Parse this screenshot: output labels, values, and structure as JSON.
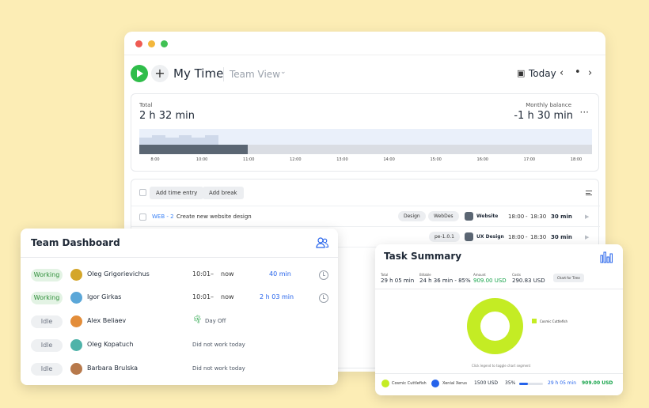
{
  "app": {
    "title": "My Time",
    "view_dropdown": "Team View",
    "date_label": "Today",
    "nav_prev": "‹",
    "nav_current": "•",
    "nav_next": "›",
    "add_symbol": "+",
    "more_symbol": "···"
  },
  "summary": {
    "total_label": "Total",
    "total_value": "2 h 32 min",
    "balance_label": "Monthly balance",
    "balance_value": "-1 h 30 min",
    "timeline_fill_fraction": 0.24,
    "ticks": [
      "8:00",
      "10:00",
      "11:00",
      "12:00",
      "13:00",
      "14:00",
      "15:00",
      "16:00",
      "17:00",
      "18:00"
    ]
  },
  "entries": {
    "add_entry_label": "Add time entry",
    "add_break_label": "Add break",
    "rows": [
      {
        "project": "WEB - 2",
        "description": "Create new website design",
        "tags": [
          "Design",
          "WebDes"
        ],
        "project_name": "Website",
        "start": "18:00",
        "dash": "-",
        "end": "18:30",
        "duration": "30 min"
      },
      {
        "project": "",
        "description": "",
        "tags": [
          "pe-1.0.1"
        ],
        "project_name": "UX Design",
        "start": "18:00",
        "dash": "-",
        "end": "18:30",
        "duration": "30 min"
      }
    ]
  },
  "team_dashboard": {
    "title": "Team Dashboard",
    "members": [
      {
        "status": "Working",
        "name": "Oleg Grigorievichus",
        "start": "10:01",
        "dash": "–",
        "end": "now",
        "duration": "40 min",
        "note": ""
      },
      {
        "status": "Working",
        "name": "Igor Girkas",
        "start": "10:01",
        "dash": "–",
        "end": "now",
        "duration": "2 h 03 min",
        "note": ""
      },
      {
        "status": "Idle",
        "name": "Alex Beliaev",
        "start": "",
        "dash": "",
        "end": "",
        "duration": "",
        "note": "Day Off"
      },
      {
        "status": "Idle",
        "name": "Oleg Kopatuch",
        "start": "",
        "dash": "",
        "end": "",
        "duration": "",
        "note": "Did not work today"
      },
      {
        "status": "Idle",
        "name": "Barbara Brulska",
        "start": "",
        "dash": "",
        "end": "",
        "duration": "",
        "note": "Did not work today"
      }
    ]
  },
  "task_summary": {
    "title": "Task Summary",
    "stats": [
      {
        "label": "Total",
        "value": "29 h 05 min"
      },
      {
        "label": "Billable",
        "value": "24 h 36 min - 85%"
      },
      {
        "label": "Amount",
        "value": "909.00 USD"
      },
      {
        "label": "Costs",
        "value": "290.83 USD"
      }
    ],
    "group_chip": "Chart for Time",
    "legend": "Cosmic Cuttlefish",
    "note": "Click legend to toggle chart segment",
    "footer": {
      "item1": "Cosmic Cuttlefish",
      "item2": "Xenial Xerus",
      "rate": "1500 USD",
      "percent": "35%",
      "bar_fraction": 0.35,
      "time": "29 h 05 min",
      "amount": "909.00 USD"
    }
  }
}
